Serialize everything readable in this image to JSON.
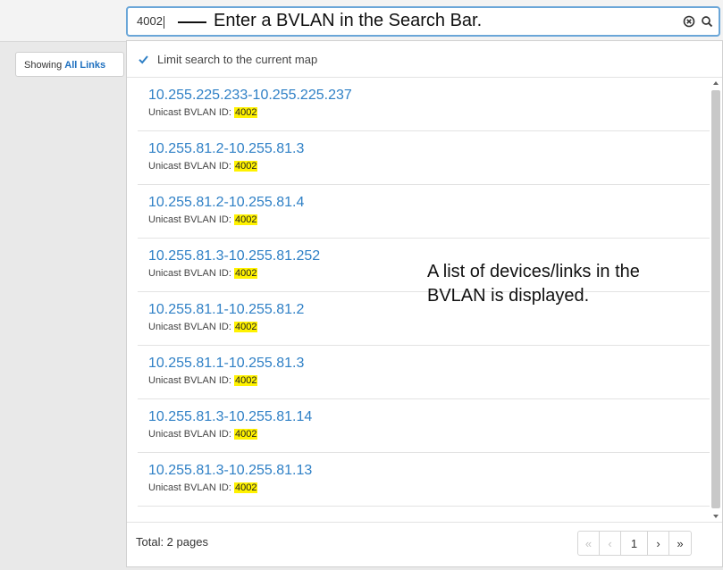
{
  "showing": {
    "prefix": "Showing",
    "value": "All Links"
  },
  "search": {
    "value": "4002"
  },
  "callouts": {
    "search": "Enter a BVLAN in the Search Bar.",
    "list": "A list of devices/links in the BVLAN is displayed."
  },
  "limit_search": {
    "label": "Limit search to the current map",
    "checked": true
  },
  "results": [
    {
      "title": "10.255.225.233-10.255.225.237",
      "sub": "Unicast BVLAN ID:",
      "id": "4002"
    },
    {
      "title": "10.255.81.2-10.255.81.3",
      "sub": "Unicast BVLAN ID:",
      "id": "4002"
    },
    {
      "title": "10.255.81.2-10.255.81.4",
      "sub": "Unicast BVLAN ID:",
      "id": "4002"
    },
    {
      "title": "10.255.81.3-10.255.81.252",
      "sub": "Unicast BVLAN ID:",
      "id": "4002"
    },
    {
      "title": "10.255.81.1-10.255.81.2",
      "sub": "Unicast BVLAN ID:",
      "id": "4002"
    },
    {
      "title": "10.255.81.1-10.255.81.3",
      "sub": "Unicast BVLAN ID:",
      "id": "4002"
    },
    {
      "title": "10.255.81.3-10.255.81.14",
      "sub": "Unicast BVLAN ID:",
      "id": "4002"
    },
    {
      "title": "10.255.81.3-10.255.81.13",
      "sub": "Unicast BVLAN ID:",
      "id": "4002"
    }
  ],
  "footer": {
    "total": "Total: 2 pages"
  },
  "pager": {
    "first": "«",
    "prev": "‹",
    "page": "1",
    "next": "›",
    "last": "»"
  },
  "colors": {
    "link": "#2f80c6",
    "highlight": "#fff200",
    "focus_border": "#6aa6d8"
  },
  "icons": {
    "clear": "clear-icon",
    "search": "search-icon",
    "checkbox": "checkbox-checked-icon"
  }
}
